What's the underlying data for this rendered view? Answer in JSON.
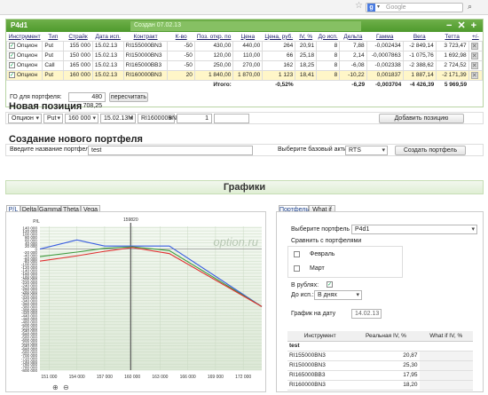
{
  "browser": {
    "search_placeholder": "Google",
    "search_engine": "g"
  },
  "portfolio": {
    "title": "P4d1",
    "created": "Создан 07.02.13",
    "columns": [
      "Инструмент",
      "Тип",
      "Страйк",
      "Дата исп.",
      "Контракт",
      "К-во",
      "Поз. откр. по",
      "Цена",
      "Цена, руб.",
      "IV, %",
      "До исп.",
      "Дельта",
      "Гамма",
      "Вега",
      "Тетта",
      "+/-"
    ],
    "rows": [
      {
        "checked": true,
        "instrument": "Опцион",
        "type": "Put",
        "strike": "155 000",
        "date": "15.02.13",
        "contract": "RI155000BN3",
        "qty": "-50",
        "open": "430,00",
        "price": "440,00",
        "price_rub": "264",
        "iv": "20,91",
        "days": "8",
        "delta": "7,88",
        "gamma": "-0,002434",
        "vega": "-2 849,14",
        "theta": "3 723,47"
      },
      {
        "checked": true,
        "instrument": "Опцион",
        "type": "Put",
        "strike": "150 000",
        "date": "15.02.13",
        "contract": "RI150000BN3",
        "qty": "-50",
        "open": "120,00",
        "price": "110,00",
        "price_rub": "66",
        "iv": "25,18",
        "days": "8",
        "delta": "2,14",
        "gamma": "-0,0007863",
        "vega": "-1 075,76",
        "theta": "1 692,98"
      },
      {
        "checked": true,
        "instrument": "Опцион",
        "type": "Call",
        "strike": "165 000",
        "date": "15.02.13",
        "contract": "RI165000BB3",
        "qty": "-50",
        "open": "250,00",
        "price": "270,00",
        "price_rub": "162",
        "iv": "18,25",
        "days": "8",
        "delta": "-6,08",
        "gamma": "-0,002338",
        "vega": "-2 388,62",
        "theta": "2 724,52"
      },
      {
        "checked": true,
        "instrument": "Опцион",
        "type": "Put",
        "strike": "160 000",
        "date": "15.02.13",
        "contract": "RI160000BN3",
        "qty": "20",
        "open": "1 840,00",
        "price": "1 870,00",
        "price_rub": "1 123",
        "iv": "18,41",
        "days": "8",
        "delta": "-10,22",
        "gamma": "0,001837",
        "vega": "1 887,14",
        "theta": "-2 171,39"
      }
    ],
    "totals": {
      "label": "Итого:",
      "pct": "-0,52%",
      "delta": "-6,29",
      "gamma": "-0,003704",
      "vega": "-4 426,39",
      "theta": "5 969,59"
    },
    "go_label": "ГО для портфеля:",
    "go_value": "480 708,25",
    "recalc_label": "пересчитать"
  },
  "new_position": {
    "heading": "Новая позиция",
    "instrument": "Опцион",
    "type": "Put",
    "strike": "160 000",
    "date": "15.02.13M",
    "contract": "RI160000BN3",
    "qty": "1",
    "add_label": "Добавить позицию"
  },
  "create_portfolio": {
    "heading": "Создание нового портфеля",
    "name_placeholder": "Введите название портфеля",
    "name_value": "test",
    "asset_label": "Выберите базовый актив",
    "asset_value": "RTS",
    "create_label": "Создать портфель"
  },
  "graphs": {
    "heading": "Графики",
    "tabs": [
      "P/L",
      "Delta",
      "Gamma",
      "Theta",
      "Vega"
    ],
    "watermark": "option.ru",
    "current_price_label": "159820"
  },
  "chart_data": {
    "type": "line",
    "title": "",
    "ylabel": "P/L",
    "xlabel": "",
    "x_ticks": [
      "151 000",
      "154 000",
      "157 000",
      "160 000",
      "163 000",
      "166 000",
      "169 000",
      "172 000"
    ],
    "y_ticks": [
      "140 000",
      "120 000",
      "100 000",
      "80 000",
      "60 000",
      "40 000",
      "20 000",
      "0",
      "-20 000",
      "-40 000",
      "-60 000",
      "-80 000",
      "-100 000",
      "-120 000",
      "-140 000",
      "-160 000",
      "-180 000",
      "-200 000",
      "-220 000",
      "-240 000",
      "-260 000",
      "-280 000",
      "-300 000",
      "-320 000",
      "-340 000",
      "-360 000",
      "-380 000",
      "-400 000",
      "-420 000",
      "-440 000",
      "-460 000",
      "-480 000",
      "-500 000",
      "-520 000",
      "-540 000",
      "-560 000",
      "-580 000",
      "-600 000",
      "-620 000",
      "-640 000",
      "-660 000",
      "-680 000",
      "-700 000",
      "-720 000",
      "-740 000",
      "-760 000",
      "-780 000",
      "-800 000"
    ],
    "ylim": [
      -800000,
      150000
    ],
    "xlim": [
      150000,
      174000
    ],
    "vline_x": 159820,
    "series": [
      {
        "color": "#3a5ee0",
        "x": [
          150000,
          154000,
          157000,
          160000,
          164000,
          174000
        ],
        "y": [
          0,
          60000,
          20000,
          20000,
          20000,
          -380000
        ]
      },
      {
        "color": "#3f9a3f",
        "x": [
          150000,
          154000,
          157000,
          160000,
          164000,
          174000
        ],
        "y": [
          -50000,
          -20000,
          5000,
          15000,
          -10000,
          -380000
        ]
      },
      {
        "color": "#e03030",
        "x": [
          150000,
          154000,
          157000,
          160000,
          164000,
          174000
        ],
        "y": [
          -80000,
          -45000,
          -15000,
          10000,
          -30000,
          -380000
        ]
      }
    ]
  },
  "right_panel": {
    "tabs": [
      "Портфель",
      "What if"
    ],
    "choose_label": "Выберите портфель",
    "choose_value": "P4d1",
    "compare_label": "Сравнить с портфелями",
    "compare_items": [
      {
        "label": "Февраль",
        "checked": false
      },
      {
        "label": "Март",
        "checked": false
      }
    ],
    "rub_label": "В рублях:",
    "rub_checked": true,
    "till_label": "До исп.:",
    "till_value": "В днях",
    "date_label": "График на дату",
    "date_value": "14.02.13",
    "table_headers": [
      "Инструмент",
      "Реальная IV, %",
      "What if IV, %"
    ],
    "table_group": "test",
    "table_rows": [
      {
        "instrument": "RI155000BN3",
        "iv": "20,87"
      },
      {
        "instrument": "RI150000BN3",
        "iv": "25,30"
      },
      {
        "instrument": "RI165000BB3",
        "iv": "17,95"
      },
      {
        "instrument": "RI160000BN3",
        "iv": "18,20"
      }
    ]
  }
}
